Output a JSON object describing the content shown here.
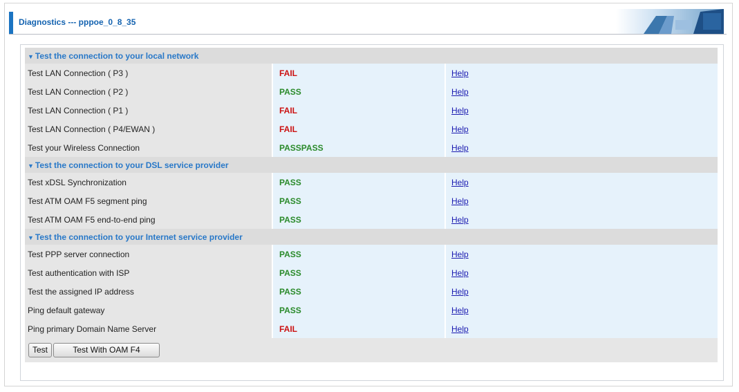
{
  "header": {
    "title": "Diagnostics --- pppoe_0_8_35"
  },
  "colors": {
    "pass": "#2a8a2a",
    "fail": "#cc1111",
    "section": "#2878c8",
    "accent": "#1b74c2"
  },
  "sections": [
    {
      "title": "Test the connection to your local network",
      "rows": [
        {
          "name": "Test LAN Connection ( P3 )",
          "status": "FAIL",
          "help": "Help"
        },
        {
          "name": "Test LAN Connection ( P2 )",
          "status": "PASS",
          "help": "Help"
        },
        {
          "name": "Test LAN Connection ( P1 )",
          "status": "FAIL",
          "help": "Help"
        },
        {
          "name": "Test LAN Connection ( P4/EWAN )",
          "status": "FAIL",
          "help": "Help"
        },
        {
          "name": "Test your Wireless Connection",
          "status": "PASSPASS",
          "help": "Help"
        }
      ]
    },
    {
      "title": "Test the connection to your DSL service provider",
      "rows": [
        {
          "name": "Test xDSL Synchronization",
          "status": "PASS",
          "help": "Help"
        },
        {
          "name": "Test ATM OAM F5 segment ping",
          "status": "PASS",
          "help": "Help"
        },
        {
          "name": "Test ATM OAM F5 end-to-end ping",
          "status": "PASS",
          "help": "Help"
        }
      ]
    },
    {
      "title": "Test the connection to your Internet service provider",
      "rows": [
        {
          "name": "Test PPP server connection",
          "status": "PASS",
          "help": "Help"
        },
        {
          "name": "Test authentication with ISP",
          "status": "PASS",
          "help": "Help"
        },
        {
          "name": "Test the assigned IP address",
          "status": "PASS",
          "help": "Help"
        },
        {
          "name": "Ping default gateway",
          "status": "PASS",
          "help": "Help"
        },
        {
          "name": "Ping primary Domain Name Server",
          "status": "FAIL",
          "help": "Help"
        }
      ]
    }
  ],
  "buttons": {
    "test": "Test",
    "test_oam_f4": "Test With OAM F4"
  }
}
